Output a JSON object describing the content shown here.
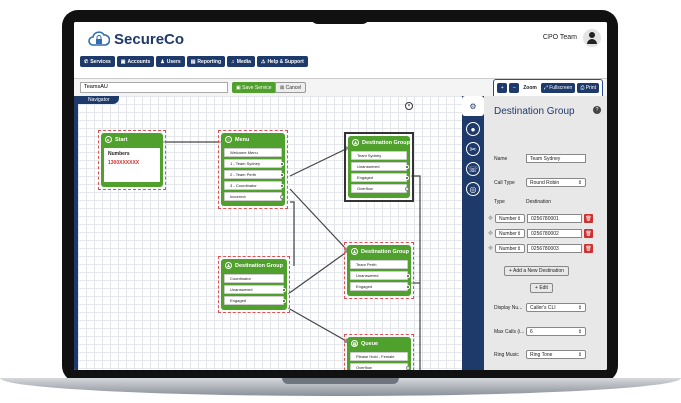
{
  "brand": {
    "name": "SecureCo"
  },
  "header": {
    "team_label": "CPO Team"
  },
  "nav": [
    {
      "icon": "phone-icon",
      "label": "Services"
    },
    {
      "icon": "accounts-icon",
      "label": "Accounts"
    },
    {
      "icon": "users-icon",
      "label": "Users"
    },
    {
      "icon": "reporting-icon",
      "label": "Reporting"
    },
    {
      "icon": "media-icon",
      "label": "Media"
    },
    {
      "icon": "help-icon",
      "label": "Help & Support"
    }
  ],
  "toolbar": {
    "service_name": "TeamsAU",
    "save_label": "Save Service",
    "cancel_label": "Cancel",
    "zoom_in": "+",
    "zoom_out": "–",
    "zoom_label": "Zoom",
    "fullscreen_label": "Fullscreen",
    "print_label": "Print"
  },
  "canvas": {
    "navigator_label": "Navigator",
    "close_label": "×"
  },
  "nodes": {
    "start": {
      "title": "Start",
      "label": "Numbers",
      "number": "1300XXXXXX"
    },
    "menu": {
      "title": "Menu",
      "rows": [
        "Welcome Menu",
        "1 - Team Sydney",
        "2 - Team Perth",
        "3 - Coordinator",
        "Incorrect"
      ]
    },
    "dest_coord": {
      "title": "Destination Group",
      "rows": [
        "Coordinator",
        "Unanswered",
        "Engaged"
      ]
    },
    "dest_sydney": {
      "title": "Destination Group",
      "rows": [
        "Team Sydney",
        "Unanswered",
        "Engaged",
        "Overflow"
      ]
    },
    "dest_perth": {
      "title": "Destination Group",
      "rows": [
        "Team Perth",
        "Unanswered",
        "Engaged"
      ]
    },
    "queue": {
      "title": "Queue",
      "rows": [
        "Please Hold - Female",
        "Overflow"
      ]
    }
  },
  "panel": {
    "title": "Destination Group",
    "name_label": "Name",
    "name_value": "Team Sydney",
    "call_type_label": "Call Type",
    "call_type_value": "Round Robin",
    "type_header": "Type",
    "destination_header": "Destination",
    "destinations": [
      {
        "type": "Number",
        "value": "0256780001"
      },
      {
        "type": "Number",
        "value": "0256780002"
      },
      {
        "type": "Number",
        "value": "0256780003"
      }
    ],
    "add_label": "+ Add a New Destination",
    "edit_label": "Edit",
    "display_label": "Display Nu...",
    "display_value": "Caller's CLI",
    "max_calls_label": "Max Calls (i...",
    "max_calls_value": "6",
    "ring_music_label": "Ring Music",
    "ring_music_value": "Ring Tone"
  },
  "colors": {
    "brand_navy": "#1e3a6b",
    "node_green": "#4fa02c",
    "delete_red": "#d03030"
  }
}
